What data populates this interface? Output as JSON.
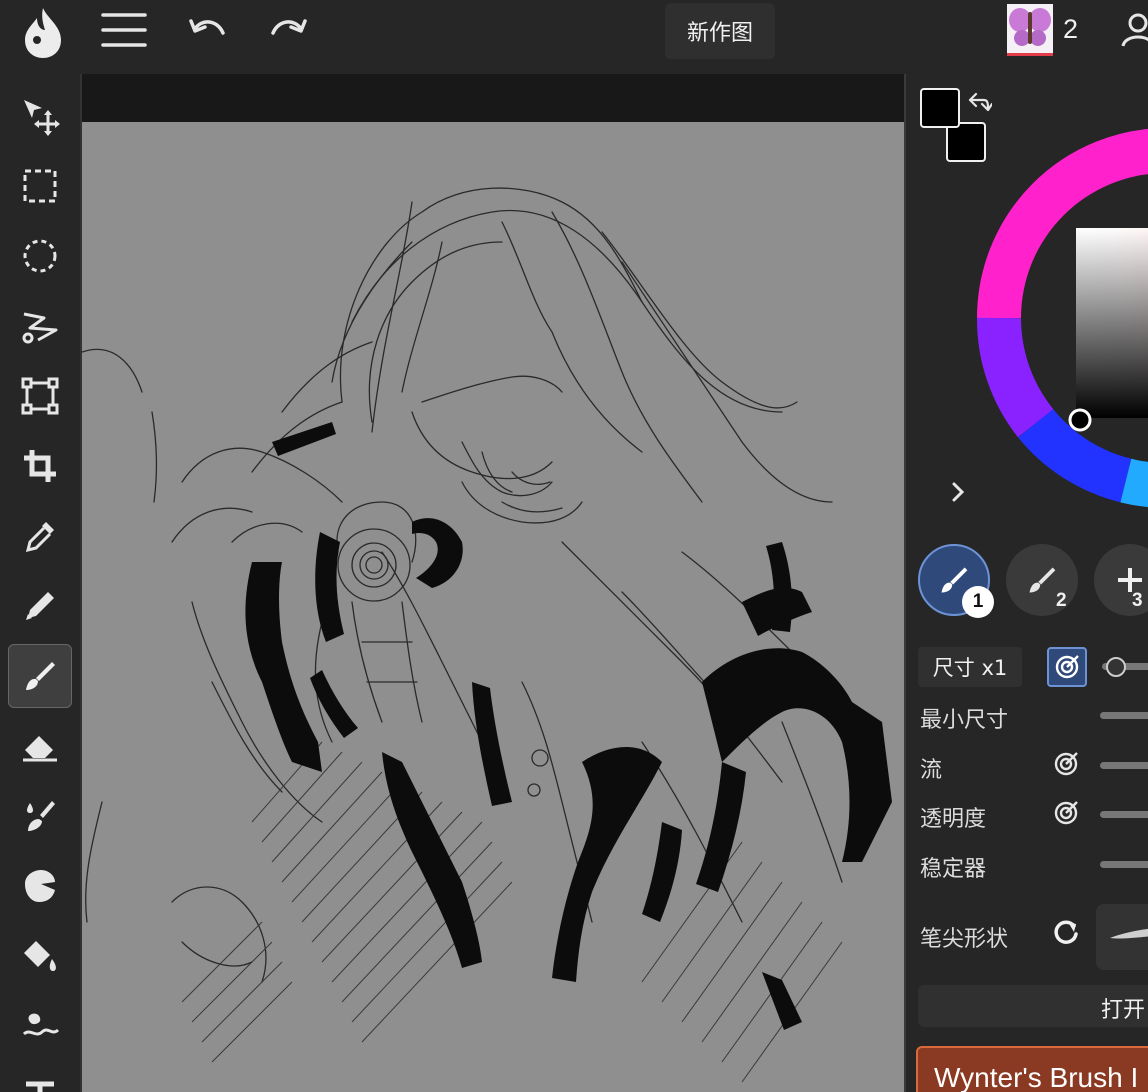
{
  "topbar": {
    "document_title": "新作图",
    "user_count": "2",
    "icons": [
      "app-logo-icon",
      "menu-icon",
      "undo-icon",
      "redo-icon",
      "user-icon"
    ]
  },
  "toolbar": {
    "tools": [
      {
        "name": "move-tool",
        "icon": "move-icon"
      },
      {
        "name": "rect-select-tool",
        "icon": "rect-select-icon"
      },
      {
        "name": "ellipse-select-tool",
        "icon": "ellipse-select-icon"
      },
      {
        "name": "lasso-tool",
        "icon": "lasso-icon"
      },
      {
        "name": "transform-tool",
        "icon": "transform-icon"
      },
      {
        "name": "crop-tool",
        "icon": "crop-icon"
      },
      {
        "name": "eyedropper-tool",
        "icon": "eyedropper-icon"
      },
      {
        "name": "pencil-tool",
        "icon": "pencil-icon"
      },
      {
        "name": "brush-tool",
        "icon": "brush-icon",
        "active": true
      },
      {
        "name": "eraser-tool",
        "icon": "eraser-icon"
      },
      {
        "name": "smudge-tool",
        "icon": "smudge-icon"
      },
      {
        "name": "blur-tool",
        "icon": "blur-icon"
      },
      {
        "name": "fill-tool",
        "icon": "fill-icon"
      },
      {
        "name": "liquify-tool",
        "icon": "liquify-icon"
      },
      {
        "name": "text-tool",
        "icon": "text-icon"
      }
    ]
  },
  "panel": {
    "primary_color": "#000000",
    "secondary_color": "#000000",
    "brush_slots": [
      {
        "label": "1",
        "active": true
      },
      {
        "label": "2",
        "active": false
      },
      {
        "label": "3",
        "active": false
      }
    ],
    "size_label": "尺寸 x1",
    "rows": {
      "min_size": "最小尺寸",
      "flow": "流",
      "opacity": "透明度",
      "stabilizer": "稳定器",
      "tip_shape": "笔尖形状"
    },
    "open_button": "打开",
    "brush_card": "Wynter's Brush I"
  },
  "colors": {
    "accent": "#6d93d6",
    "canvas_bg": "#8f8f8f",
    "brush_card": "#8a3a22"
  }
}
